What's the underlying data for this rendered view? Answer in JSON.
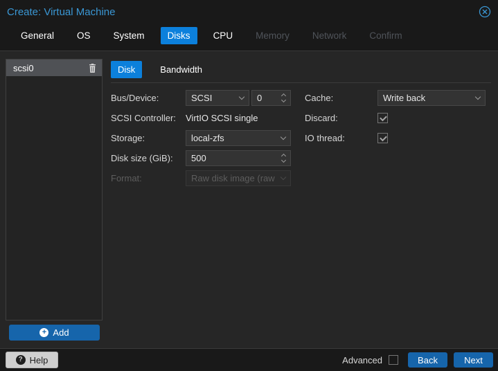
{
  "window": {
    "title": "Create: Virtual Machine"
  },
  "wizard_tabs": [
    {
      "label": "General",
      "state": "enabled"
    },
    {
      "label": "OS",
      "state": "enabled"
    },
    {
      "label": "System",
      "state": "enabled"
    },
    {
      "label": "Disks",
      "state": "active"
    },
    {
      "label": "CPU",
      "state": "enabled"
    },
    {
      "label": "Memory",
      "state": "disabled"
    },
    {
      "label": "Network",
      "state": "disabled"
    },
    {
      "label": "Confirm",
      "state": "disabled"
    }
  ],
  "sidebar": {
    "items": [
      {
        "label": "scsi0",
        "selected": true
      }
    ],
    "add_button_label": "Add"
  },
  "disk_panel": {
    "tabs": [
      {
        "label": "Disk",
        "active": true
      },
      {
        "label": "Bandwidth",
        "active": false
      }
    ],
    "fields": {
      "bus_device": {
        "label": "Bus/Device:",
        "bus_value": "SCSI",
        "device_value": "0"
      },
      "scsi_controller": {
        "label": "SCSI Controller:",
        "value": "VirtIO SCSI single"
      },
      "storage": {
        "label": "Storage:",
        "value": "local-zfs"
      },
      "disk_size": {
        "label": "Disk size (GiB):",
        "value": "500"
      },
      "format": {
        "label": "Format:",
        "value": "Raw disk image (raw",
        "disabled": true
      },
      "cache": {
        "label": "Cache:",
        "value": "Write back"
      },
      "discard": {
        "label": "Discard:",
        "checked": true
      },
      "io_thread": {
        "label": "IO thread:",
        "checked": true
      }
    }
  },
  "footer": {
    "help_label": "Help",
    "advanced_label": "Advanced",
    "advanced_checked": false,
    "back_label": "Back",
    "next_label": "Next"
  },
  "colors": {
    "accent_tab_blue": "#0c80dc",
    "button_blue": "#1665ab",
    "title_blue": "#3a97d4",
    "selected_item_gray": "#4f5155"
  }
}
